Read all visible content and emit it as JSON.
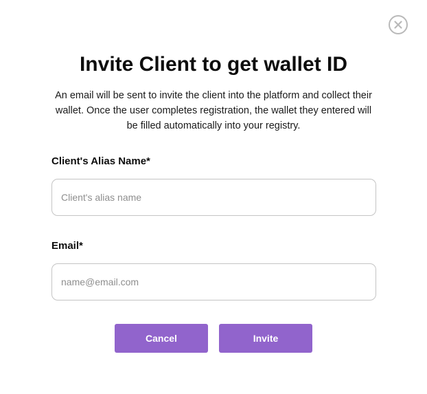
{
  "modal": {
    "close_icon": "close-icon",
    "title": "Invite Client to get wallet ID",
    "description": "An email will be sent to invite the client into the platform and collect their wallet. Once the user completes registration, the wallet they entered will be filled automatically into your registry."
  },
  "form": {
    "alias": {
      "label": "Client's Alias Name*",
      "placeholder": "Client's alias name",
      "value": ""
    },
    "email": {
      "label": "Email*",
      "placeholder": "name@email.com",
      "value": ""
    }
  },
  "actions": {
    "cancel_label": "Cancel",
    "invite_label": "Invite"
  },
  "colors": {
    "button_bg": "#9164cc",
    "button_text": "#ffffff",
    "input_border": "#c4c4c4",
    "close_icon": "#b9b9b9"
  }
}
